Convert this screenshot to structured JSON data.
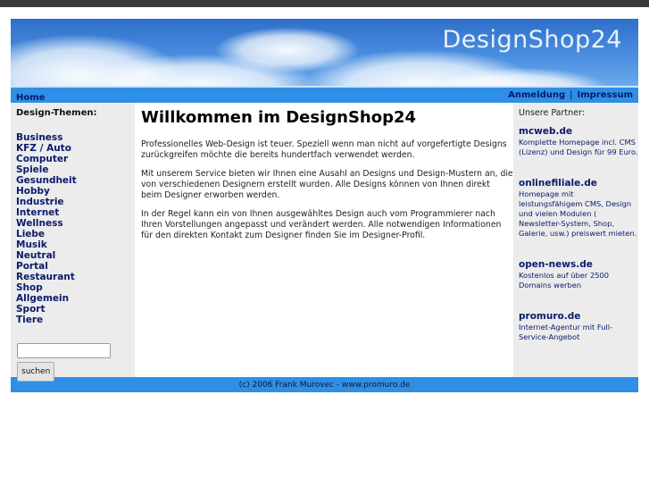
{
  "header": {
    "brand": "DesignShop24"
  },
  "nav": {
    "home": "Home",
    "login": "Anmeldung",
    "separator": "|",
    "imprint": "Impressum"
  },
  "sidebar": {
    "title": "Design-Themen:",
    "items": [
      "Business",
      "KFZ / Auto",
      "Computer",
      "Spiele",
      "Gesundheit",
      "Hobby",
      "Industrie",
      "Internet",
      "Wellness",
      "Liebe",
      "Musik",
      "Neutral",
      "Portal",
      "Restaurant",
      "Shop",
      "Allgemein",
      "Sport",
      "Tiere"
    ],
    "search_value": "",
    "search_button": "suchen"
  },
  "main": {
    "title": "Willkommen im DesignShop24",
    "paragraphs": [
      "Professionelles Web-Design ist teuer. Speziell wenn man nicht auf vorgefertigte Designs zurückgreifen möchte die bereits hundertfach verwendet werden.",
      "Mit unserem Service bieten wir Ihnen eine Ausahl an Designs und Design-Mustern an, die von verschiedenen Designern erstellt wurden. Alle Designs können von Ihnen direkt beim Designer erworben werden.",
      "In der Regel kann ein von Ihnen ausgewähltes Design auch vom Programmierer nach Ihren Vorstellungen angepasst und verändert werden. Alle notwendigen Informationen für den direkten Kontakt zum Designer finden Sie im Designer-Profil."
    ]
  },
  "partners": {
    "title": "Unsere Partner:",
    "items": [
      {
        "name": "mcweb.de",
        "desc": "Komplette Homepage incl. CMS (Lizenz) und Design für 99 Euro."
      },
      {
        "name": "onlinefiliale.de",
        "desc": "Homepage mit leistungsfähigem CMS, Design und vielen Modulen ( Newsletter-System, Shop, Galerie, usw.) preiswert mieten."
      },
      {
        "name": "open-news.de",
        "desc": "Kostenlos auf über 2500 Domains werben"
      },
      {
        "name": "promuro.de",
        "desc": "Internet-Agentur mit Full-Service-Angebot"
      }
    ]
  },
  "footer": {
    "text": "(c) 2006 Frank Murovec - www.promuro.de"
  }
}
